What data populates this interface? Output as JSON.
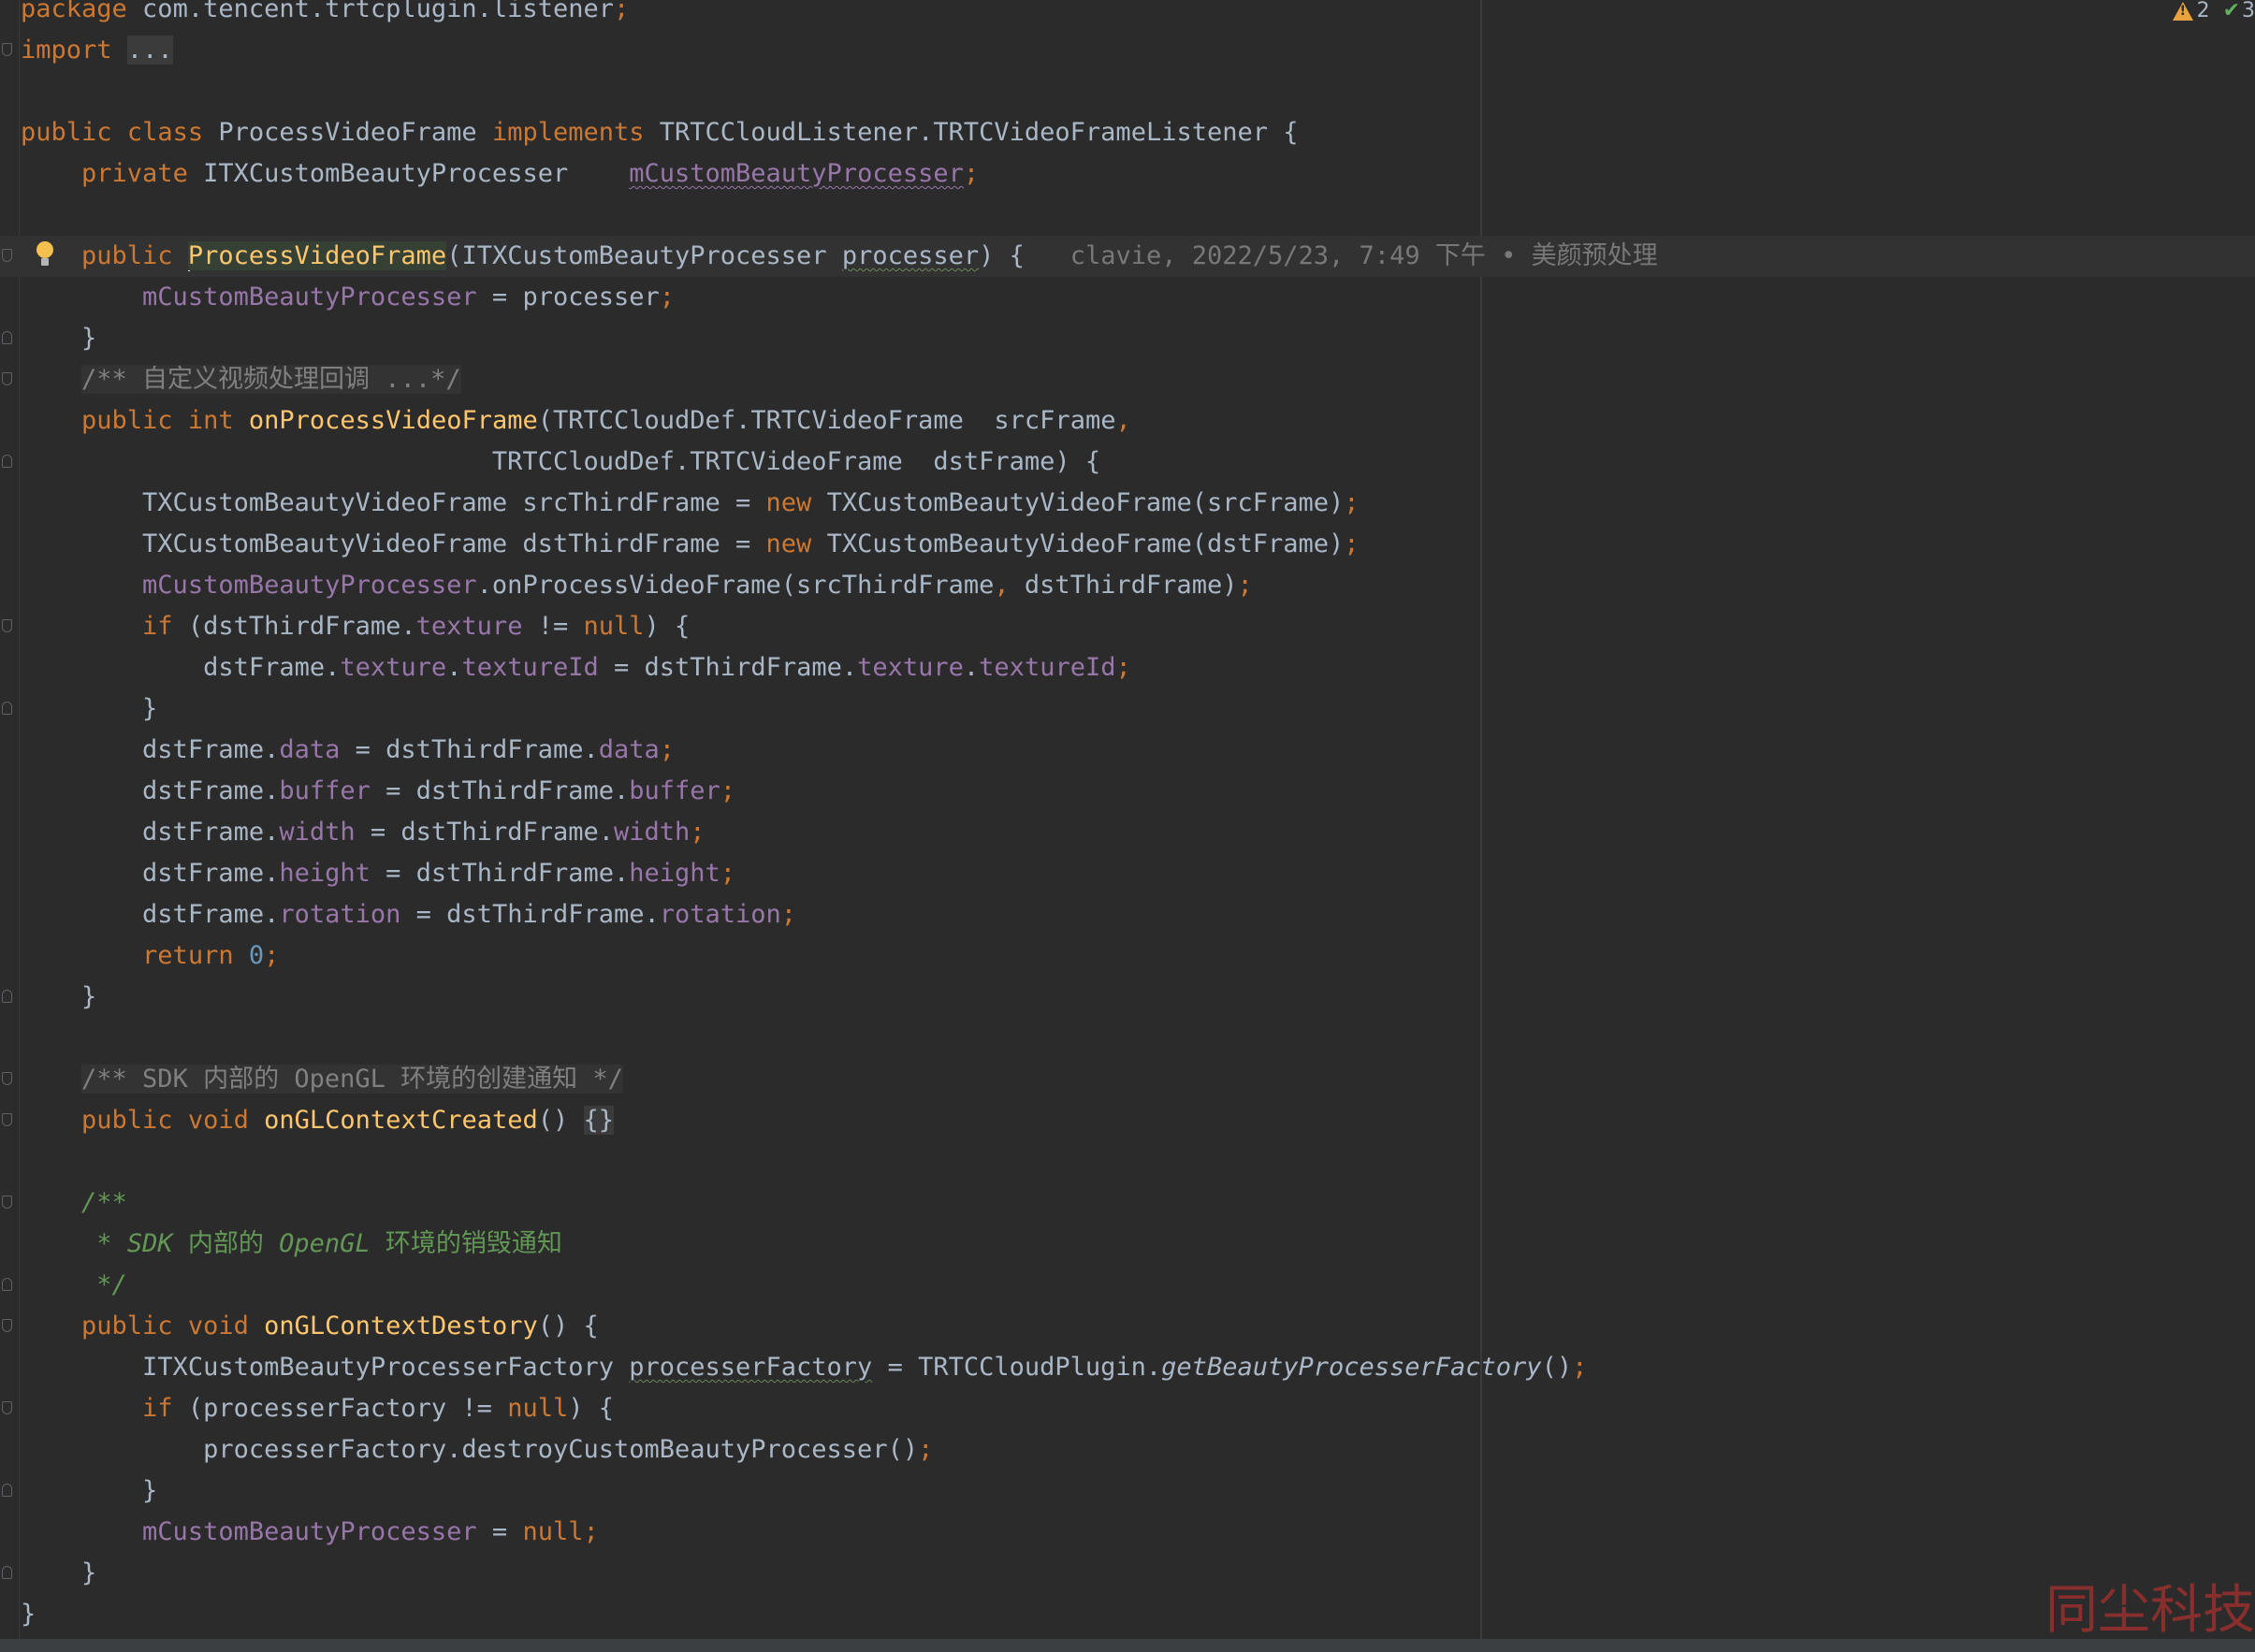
{
  "inspections": {
    "warnings": "2",
    "passed": "3"
  },
  "blame": "clavie, 2022/5/23, 7:49 下午 • 美颜预处理",
  "watermark": "同尘科技",
  "code": {
    "l1_pkg": "package",
    "l1_name": " com.tencent.trtcplugin.listener",
    "l2_import": "import",
    "l2_dots": "...",
    "l4_public": "public",
    "l4_class": "class",
    "l4_name": " ProcessVideoFrame ",
    "l4_implements": "implements",
    "l4_iface": " TRTCCloudListener.TRTCVideoFrameListener {",
    "l5_private": "private",
    "l5_type": " ITXCustomBeautyProcesser    ",
    "l5_field": "mCustomBeautyProcesser",
    "l7_public": "public",
    "l7_ctor": "ProcessVideoFrame",
    "l7_params1": "(ITXCustomBeautyProcesser ",
    "l7_param": "processer",
    "l7_params2": ") {",
    "l8_field": "mCustomBeautyProcesser",
    "l8_rest": " = processer",
    "l9": "}",
    "l10_comment": "/** 自定义视频处理回调 ...*/",
    "l11_public": "public",
    "l11_int": "int",
    "l11_fn": "onProcessVideoFrame",
    "l11_rest": "(TRTCCloudDef.TRTCVideoFrame  srcFrame",
    "l12": "TRTCCloudDef.TRTCVideoFrame  dstFrame) {",
    "l13_a": "TXCustomBeautyVideoFrame srcThirdFrame = ",
    "l13_new": "new",
    "l13_b": " TXCustomBeautyVideoFrame(srcFrame)",
    "l14_a": "TXCustomBeautyVideoFrame dstThirdFrame = ",
    "l14_new": "new",
    "l14_b": " TXCustomBeautyVideoFrame(dstFrame)",
    "l15_field": "mCustomBeautyProcesser",
    "l15_a": ".onProcessVideoFrame(srcThirdFrame",
    "l15_b": " dstThirdFrame)",
    "l16_if": "if",
    "l16_a": " (dstThirdFrame.",
    "l16_texture": "texture",
    "l16_b": " != ",
    "l16_null": "null",
    "l16_c": ") {",
    "l17_a": "dstFrame.",
    "l17_texture": "texture",
    "l17_dot": ".",
    "l17_texid": "textureId",
    "l17_b": " = dstThirdFrame.",
    "l17_texture2": "texture",
    "l17_dot2": ".",
    "l17_texid2": "textureId",
    "l18": "}",
    "l19_a": "dstFrame.",
    "l19_f": "data",
    "l19_b": " = dstThirdFrame.",
    "l19_f2": "data",
    "l20_a": "dstFrame.",
    "l20_f": "buffer",
    "l20_b": " = dstThirdFrame.",
    "l20_f2": "buffer",
    "l21_a": "dstFrame.",
    "l21_f": "width",
    "l21_b": " = dstThirdFrame.",
    "l21_f2": "width",
    "l22_a": "dstFrame.",
    "l22_f": "height",
    "l22_b": " = dstThirdFrame.",
    "l22_f2": "height",
    "l23_a": "dstFrame.",
    "l23_f": "rotation",
    "l23_b": " = dstThirdFrame.",
    "l23_f2": "rotation",
    "l24_return": "return",
    "l24_num": "0",
    "l25": "}",
    "l27_comment": "/** SDK 内部的 OpenGL 环境的创建通知 */",
    "l28_public": "public",
    "l28_void": "void",
    "l28_fn": "onGLContextCreated",
    "l28_paren": "() ",
    "l28_body": "{}",
    "l30_doc": "/**",
    "l31_star": " * ",
    "l31_a": "SDK",
    "l31_b": " 内部的 ",
    "l31_c": "OpenGL",
    "l31_d": " 环境的销毁通知",
    "l32_doc": " */",
    "l33_public": "public",
    "l33_void": "void",
    "l33_fn": "onGLContextDestory",
    "l33_rest": "() {",
    "l34_a": "ITXCustomBeautyProcesserFactory ",
    "l34_var": "processerFactory",
    "l34_b": " = TRTCCloudPlugin.",
    "l34_call": "getBeautyProcesserFactory",
    "l34_c": "()",
    "l35_if": "if",
    "l35_a": " (processerFactory != ",
    "l35_null": "null",
    "l35_b": ") {",
    "l36": "processerFactory.destroyCustomBeautyProcesser()",
    "l37": "}",
    "l38_field": "mCustomBeautyProcesser",
    "l38_a": " = ",
    "l38_null": "null",
    "l39": "}",
    "l40": "}"
  }
}
